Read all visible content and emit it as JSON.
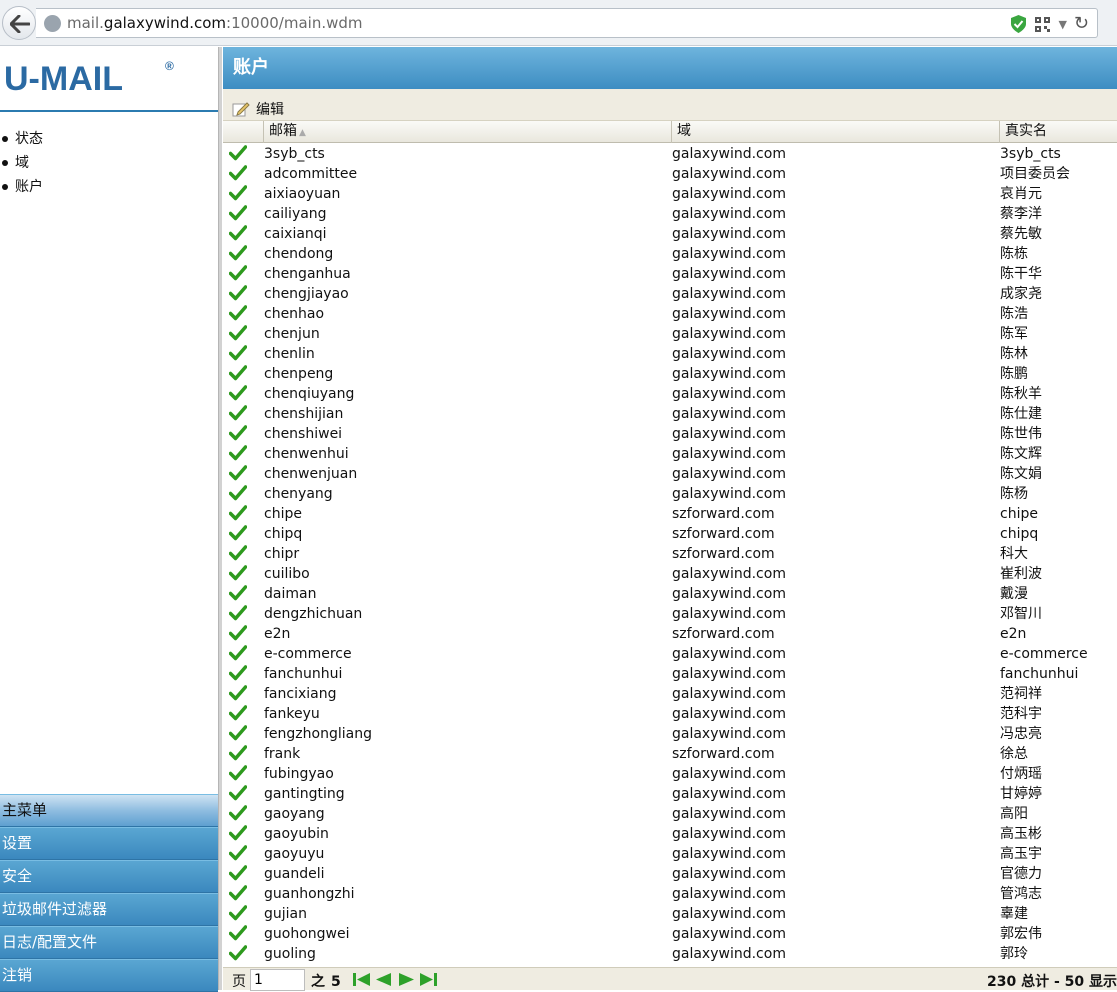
{
  "browser": {
    "url_prefix": "mail.",
    "url_host": "galaxywind.com",
    "url_suffix": ":10000/main.wdm"
  },
  "sidebar": {
    "logo": "U-MAIL",
    "logo_mark": "®",
    "tree": [
      {
        "label": "状态"
      },
      {
        "label": "域"
      },
      {
        "label": "账户"
      }
    ],
    "menu": [
      {
        "label": "主菜单",
        "active": true
      },
      {
        "label": "设置"
      },
      {
        "label": "安全"
      },
      {
        "label": "垃圾邮件过滤器"
      },
      {
        "label": "日志/配置文件"
      },
      {
        "label": "注销"
      }
    ]
  },
  "main": {
    "title": "账户",
    "toolbar": {
      "edit_label": "编辑"
    },
    "columns": {
      "mailbox": "邮箱",
      "domain": "域",
      "real_name": "真实名"
    },
    "rows": [
      {
        "mailbox": "3syb_cts",
        "domain": "galaxywind.com",
        "name": "3syb_cts"
      },
      {
        "mailbox": "adcommittee",
        "domain": "galaxywind.com",
        "name": "项目委员会"
      },
      {
        "mailbox": "aixiaoyuan",
        "domain": "galaxywind.com",
        "name": "哀肖元"
      },
      {
        "mailbox": "cailiyang",
        "domain": "galaxywind.com",
        "name": "蔡李洋"
      },
      {
        "mailbox": "caixianqi",
        "domain": "galaxywind.com",
        "name": "蔡先敏"
      },
      {
        "mailbox": "chendong",
        "domain": "galaxywind.com",
        "name": "陈栋"
      },
      {
        "mailbox": "chenganhua",
        "domain": "galaxywind.com",
        "name": "陈干华"
      },
      {
        "mailbox": "chengjiayao",
        "domain": "galaxywind.com",
        "name": "成家尧"
      },
      {
        "mailbox": "chenhao",
        "domain": "galaxywind.com",
        "name": "陈浩"
      },
      {
        "mailbox": "chenjun",
        "domain": "galaxywind.com",
        "name": "陈军"
      },
      {
        "mailbox": "chenlin",
        "domain": "galaxywind.com",
        "name": "陈林"
      },
      {
        "mailbox": "chenpeng",
        "domain": "galaxywind.com",
        "name": "陈鹏"
      },
      {
        "mailbox": "chenqiuyang",
        "domain": "galaxywind.com",
        "name": "陈秋羊"
      },
      {
        "mailbox": "chenshijian",
        "domain": "galaxywind.com",
        "name": "陈仕建"
      },
      {
        "mailbox": "chenshiwei",
        "domain": "galaxywind.com",
        "name": "陈世伟"
      },
      {
        "mailbox": "chenwenhui",
        "domain": "galaxywind.com",
        "name": "陈文辉"
      },
      {
        "mailbox": "chenwenjuan",
        "domain": "galaxywind.com",
        "name": "陈文娟"
      },
      {
        "mailbox": "chenyang",
        "domain": "galaxywind.com",
        "name": "陈杨"
      },
      {
        "mailbox": "chipe",
        "domain": "szforward.com",
        "name": "chipe"
      },
      {
        "mailbox": "chipq",
        "domain": "szforward.com",
        "name": "chipq"
      },
      {
        "mailbox": "chipr",
        "domain": "szforward.com",
        "name": "科大"
      },
      {
        "mailbox": "cuilibo",
        "domain": "galaxywind.com",
        "name": "崔利波"
      },
      {
        "mailbox": "daiman",
        "domain": "galaxywind.com",
        "name": "戴漫"
      },
      {
        "mailbox": "dengzhichuan",
        "domain": "galaxywind.com",
        "name": "邓智川"
      },
      {
        "mailbox": "e2n",
        "domain": "szforward.com",
        "name": "e2n"
      },
      {
        "mailbox": "e-commerce",
        "domain": "galaxywind.com",
        "name": "e-commerce"
      },
      {
        "mailbox": "fanchunhui",
        "domain": "galaxywind.com",
        "name": "fanchunhui"
      },
      {
        "mailbox": "fancixiang",
        "domain": "galaxywind.com",
        "name": "范祠祥"
      },
      {
        "mailbox": "fankeyu",
        "domain": "galaxywind.com",
        "name": "范科宇"
      },
      {
        "mailbox": "fengzhongliang",
        "domain": "galaxywind.com",
        "name": "冯忠亮"
      },
      {
        "mailbox": "frank",
        "domain": "szforward.com",
        "name": "徐总"
      },
      {
        "mailbox": "fubingyao",
        "domain": "galaxywind.com",
        "name": "付炳瑶"
      },
      {
        "mailbox": "gantingting",
        "domain": "galaxywind.com",
        "name": "甘婷婷"
      },
      {
        "mailbox": "gaoyang",
        "domain": "galaxywind.com",
        "name": "高阳"
      },
      {
        "mailbox": "gaoyubin",
        "domain": "galaxywind.com",
        "name": "高玉彬"
      },
      {
        "mailbox": "gaoyuyu",
        "domain": "galaxywind.com",
        "name": "高玉宇"
      },
      {
        "mailbox": "guandeli",
        "domain": "galaxywind.com",
        "name": "官德力"
      },
      {
        "mailbox": "guanhongzhi",
        "domain": "galaxywind.com",
        "name": "管鸿志"
      },
      {
        "mailbox": "gujian",
        "domain": "galaxywind.com",
        "name": "辜建"
      },
      {
        "mailbox": "guohongwei",
        "domain": "galaxywind.com",
        "name": "郭宏伟"
      },
      {
        "mailbox": "guoling",
        "domain": "galaxywind.com",
        "name": "郭玲"
      }
    ],
    "pager": {
      "page_label": "页",
      "page_value": "1",
      "of_label": "之",
      "page_count": "5",
      "summary": "230 总计 - 50 显示"
    }
  },
  "colors": {
    "accent": "#3d8dc2",
    "check": "#2e9a1e",
    "nav_green": "#2ea12a"
  }
}
